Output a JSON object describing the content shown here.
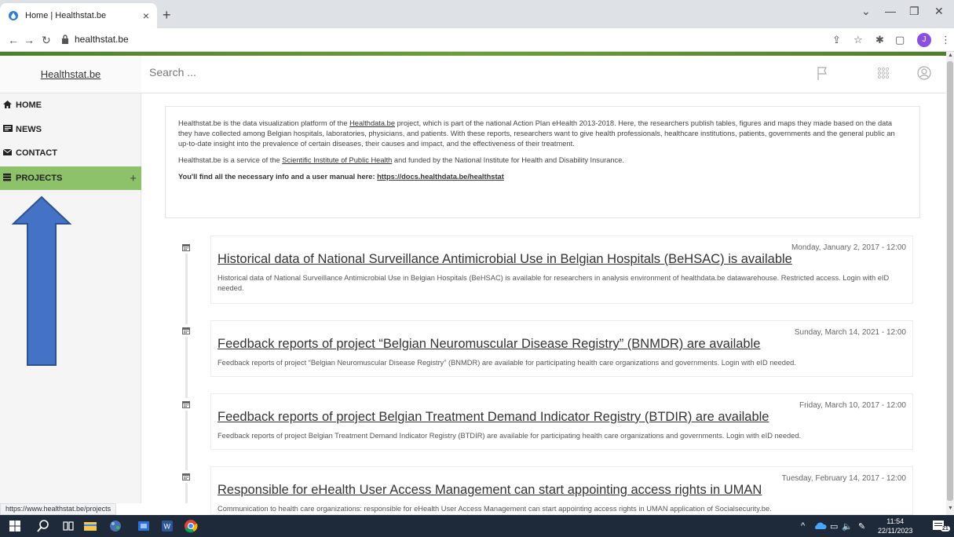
{
  "browser": {
    "tab_title": "Home | Healthstat.be",
    "url": "healthstat.be",
    "profile_initial": "J",
    "status_url": "https://www.healthstat.be/projects"
  },
  "sidebar": {
    "brand": "Healthstat.be",
    "items": [
      {
        "label": "HOME",
        "icon": "home-icon"
      },
      {
        "label": "NEWS",
        "icon": "news-icon"
      },
      {
        "label": "CONTACT",
        "icon": "envelope-icon"
      },
      {
        "label": "PROJECTS",
        "icon": "database-icon",
        "active": true
      }
    ],
    "expand_label": "+"
  },
  "search": {
    "placeholder": "Search ..."
  },
  "intro": {
    "p1_before": "Healthstat.be is the data visualization platform of the ",
    "p1_link": "Healthdata.be",
    "p1_after": " project, which is part of the national Action Plan eHealth 2013-2018. Here, the researchers publish tables, figures and maps they made based on the data they have collected among Belgian hospitals, laboratories, physicians, and patients. With these reports, researchers want to give health professionals, healthcare institutions, patients, governments and the general public an up-to-date insight into the prevalence of certain diseases, their causes and impact, and the effectiveness of their treatment.",
    "p2_before": "Healthstat.be is a service of the ",
    "p2_link": "Scientific Institute of Public Health",
    "p2_after": " and funded by the National Institute for Health and Disability Insurance.",
    "p3_text": "You'll find all the necessary info and a user manual here: ",
    "p3_link": "https://docs.healthdata.be/healthstat"
  },
  "news": [
    {
      "date": "Monday, January 2, 2017 - 12:00",
      "title": "Historical data of National Surveillance Antimicrobial Use in Belgian Hospitals (BeHSAC) is available",
      "text": "Historical data of National Surveillance Antimicrobial Use in Belgian Hospitals (BeHSAC) is available for researchers in analysis environment of healthdata.be datawarehouse. Restricted access. Login with eID needed."
    },
    {
      "date": "Sunday, March 14, 2021 - 12:00",
      "title": "Feedback reports of project “Belgian Neuromuscular Disease Registry” (BNMDR) are available",
      "text": "Feedback reports of project “Belgian Neuromuscular Disease Registry” (BNMDR) are available for participating health care organizations and governments. Login with eID needed."
    },
    {
      "date": "Friday, March 10, 2017 - 12:00",
      "title": "Feedback reports of project Belgian Treatment Demand Indicator Registry (BTDIR) are available",
      "text": "Feedback reports of project Belgian Treatment Demand Indicator Registry (BTDIR) are available for participating health care organizations and governments. Login with eID needed."
    },
    {
      "date": "Tuesday, February 14, 2017 - 12:00",
      "title": "Responsible for eHealth User Access Management can start appointing access rights in UMAN",
      "text": "Communication to health care organizations: responsible for eHealth User Access Management can start appointing access rights in UMAN application of Socialsecurity.be."
    }
  ],
  "taskbar": {
    "time": "11:54",
    "date": "22/11/2023",
    "notification_count": "21"
  },
  "colors": {
    "active_nav": "#8dc26b",
    "arrow": "#4472c4",
    "green_bar": "#5a8f32"
  }
}
